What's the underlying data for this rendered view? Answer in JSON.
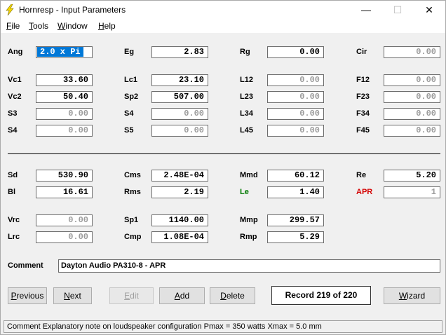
{
  "window": {
    "title": "Hornresp - Input Parameters"
  },
  "controls": {
    "minimize": "—",
    "maximize": "☐",
    "close": "✕"
  },
  "menu": [
    {
      "underline": "F",
      "rest": "ile"
    },
    {
      "underline": "T",
      "rest": "ools"
    },
    {
      "underline": "W",
      "rest": "indow"
    },
    {
      "underline": "H",
      "rest": "elp"
    }
  ],
  "params": {
    "ang": {
      "label": "Ang",
      "value": "2.0 x Pi"
    },
    "eg": {
      "label": "Eg",
      "value": "2.83"
    },
    "rg": {
      "label": "Rg",
      "value": "0.00"
    },
    "cir": {
      "label": "Cir",
      "value": "0.00"
    },
    "vc1": {
      "label": "Vc1",
      "value": "33.60"
    },
    "lc1": {
      "label": "Lc1",
      "value": "23.10"
    },
    "l12": {
      "label": "L12",
      "value": "0.00"
    },
    "f12": {
      "label": "F12",
      "value": "0.00"
    },
    "vc2": {
      "label": "Vc2",
      "value": "50.40"
    },
    "sp2": {
      "label": "Sp2",
      "value": "507.00"
    },
    "l23": {
      "label": "L23",
      "value": "0.00"
    },
    "f23": {
      "label": "F23",
      "value": "0.00"
    },
    "s3": {
      "label": "S3",
      "value": "0.00"
    },
    "s4a": {
      "label": "S4",
      "value": "0.00"
    },
    "l34": {
      "label": "L34",
      "value": "0.00"
    },
    "f34": {
      "label": "F34",
      "value": "0.00"
    },
    "s4b": {
      "label": "S4",
      "value": "0.00"
    },
    "s5": {
      "label": "S5",
      "value": "0.00"
    },
    "l45": {
      "label": "L45",
      "value": "0.00"
    },
    "f45": {
      "label": "F45",
      "value": "0.00"
    },
    "sd": {
      "label": "Sd",
      "value": "530.90"
    },
    "cms": {
      "label": "Cms",
      "value": "2.48E-04"
    },
    "mmd": {
      "label": "Mmd",
      "value": "60.12"
    },
    "re": {
      "label": "Re",
      "value": "5.20"
    },
    "bl": {
      "label": "Bl",
      "value": "16.61"
    },
    "rms": {
      "label": "Rms",
      "value": "2.19"
    },
    "le": {
      "label": "Le",
      "value": "1.40"
    },
    "apr": {
      "label": "APR",
      "value": "1"
    },
    "vrc": {
      "label": "Vrc",
      "value": "0.00"
    },
    "sp1": {
      "label": "Sp1",
      "value": "1140.00"
    },
    "mmp": {
      "label": "Mmp",
      "value": "299.57"
    },
    "lrc": {
      "label": "Lrc",
      "value": "0.00"
    },
    "cmp": {
      "label": "Cmp",
      "value": "1.08E-04"
    },
    "rmp": {
      "label": "Rmp",
      "value": "5.29"
    }
  },
  "comment": {
    "label": "Comment",
    "value": "Dayton Audio PA310-8 - APR"
  },
  "buttons": {
    "previous": {
      "underline": "P",
      "rest": "revious"
    },
    "next": {
      "underline": "N",
      "rest": "ext"
    },
    "edit": {
      "underline": "E",
      "rest": "dit"
    },
    "add": {
      "underline": "A",
      "rest": "dd"
    },
    "delete": {
      "underline": "D",
      "rest": "elete"
    },
    "wizard": {
      "underline": "W",
      "rest": "izard"
    }
  },
  "record": "Record 219 of 220",
  "status": "Comment   Explanatory note on loudspeaker configuration   Pmax = 350 watts   Xmax = 5.0 mm",
  "colors": {
    "le_label": "#007a00",
    "apr_label": "#d40000",
    "selection": "#0078d7"
  }
}
